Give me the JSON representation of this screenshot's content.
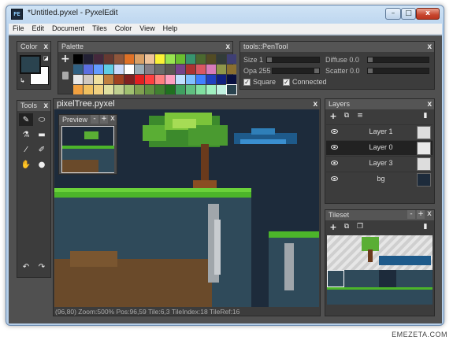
{
  "window": {
    "title": "*Untitled.pyxel - PyxelEdit",
    "icon": "PE",
    "min": "–",
    "max": "□",
    "close": "x"
  },
  "menu": [
    "File",
    "Edit",
    "Document",
    "Tiles",
    "Color",
    "View",
    "Help"
  ],
  "panels": {
    "color": {
      "title": "Color",
      "close": "x",
      "primary": "#2a434f",
      "secondary": "#ffffff"
    },
    "palette": {
      "title": "Palette",
      "close": "x",
      "add": "+",
      "trash": "trash-icon",
      "colors": [
        "#000000",
        "#222034",
        "#45283c",
        "#663931",
        "#8f563b",
        "#df7126",
        "#d9a066",
        "#eec39a",
        "#fbf236",
        "#99e550",
        "#6abe30",
        "#37946e",
        "#4b692f",
        "#524b24",
        "#323c39",
        "#3f3f74",
        "#306082",
        "#5b6ee1",
        "#639bff",
        "#5fcde4",
        "#cbdbfc",
        "#ffffff",
        "#9badb7",
        "#847e87",
        "#696a6a",
        "#595652",
        "#76428a",
        "#ac3232",
        "#d95763",
        "#d77bba",
        "#8f974a",
        "#8a6f30",
        "#e8e8e8",
        "#d0c8c0",
        "#f0e0a0",
        "#c08040",
        "#a04020",
        "#802020",
        "#e02020",
        "#ff4040",
        "#ff8080",
        "#ffa0c0",
        "#c0e0ff",
        "#80c0ff",
        "#4080ff",
        "#2040c0",
        "#102080",
        "#081040",
        "#f0a040",
        "#f0c060",
        "#f0d080",
        "#e0e0a0",
        "#c0d090",
        "#a0c070",
        "#80a050",
        "#609040",
        "#408030",
        "#207020",
        "#40a060",
        "#60c080",
        "#80e0a0",
        "#a0f0c0",
        "#c0f0e0",
        "#2a434f"
      ]
    },
    "tools": {
      "title": "Tools",
      "close": "x"
    },
    "pentool": {
      "title": "tools::PenTool",
      "close": "x",
      "size_label": "Size 1",
      "opacity_label": "Opa 255",
      "diffuse_label": "Diffuse 0.0",
      "scatter_label": "Scatter 0.0",
      "square_label": "Square",
      "connected_label": "Connected",
      "square_checked": true,
      "connected_checked": true
    },
    "canvas": {
      "title": "pixelTree.pyxel",
      "close": "x",
      "status": "(96,80) Zoom:500% Pos:96,59  Tile:6,3  TileIndex:18  TileRef:16"
    },
    "preview": {
      "title": "Preview",
      "minus": "-",
      "plus": "+",
      "close": "x"
    },
    "layers": {
      "title": "Layers",
      "close": "x",
      "items": [
        {
          "name": "Layer 1",
          "selected": false
        },
        {
          "name": "Layer 0",
          "selected": true
        },
        {
          "name": "Layer 3",
          "selected": false
        },
        {
          "name": "bg",
          "selected": false
        }
      ]
    },
    "tileset": {
      "title": "Tileset",
      "minus": "-",
      "plus": "+",
      "close": "x"
    }
  },
  "watermark": "EMEZETA.COM"
}
